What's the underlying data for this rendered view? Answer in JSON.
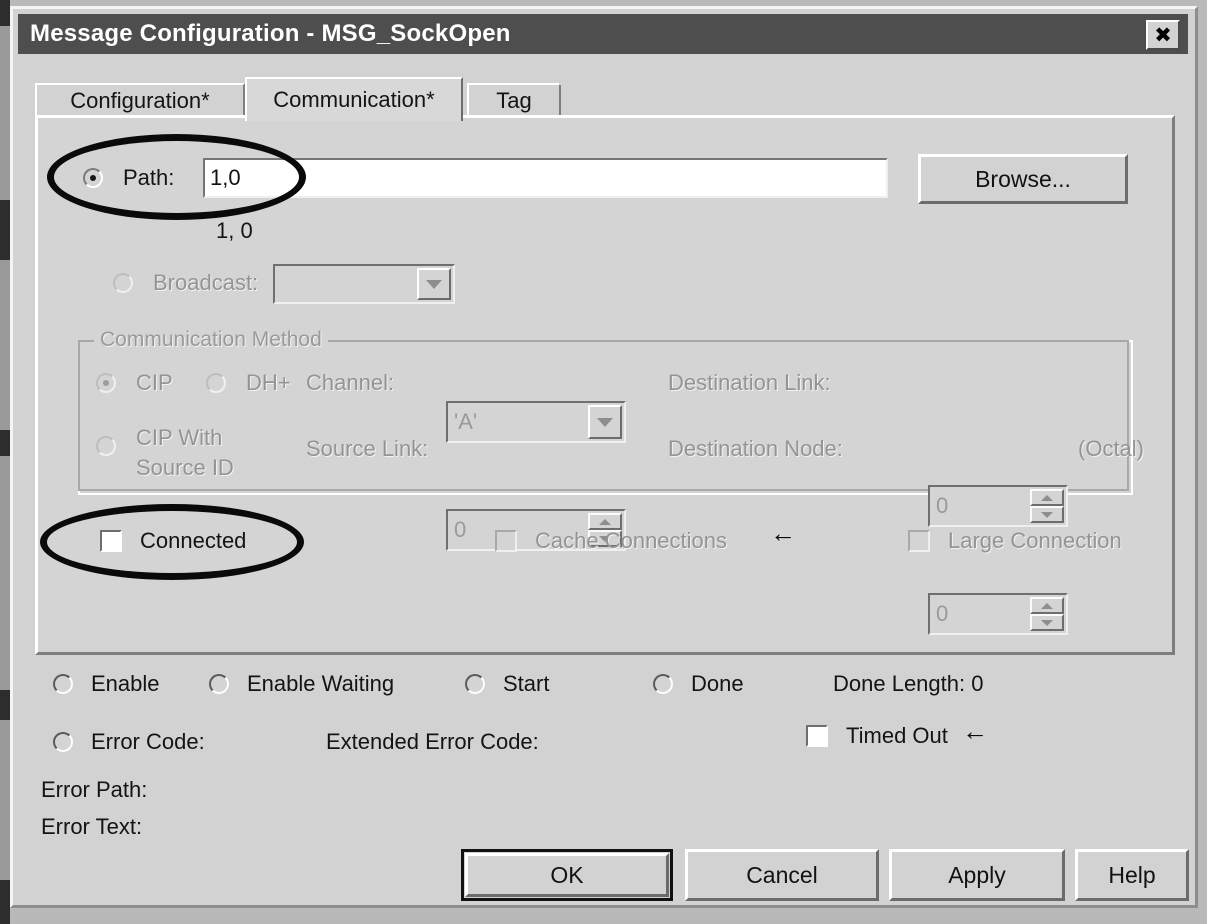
{
  "window": {
    "title": "Message Configuration - MSG_SockOpen",
    "close_label": "✖"
  },
  "tabs": [
    {
      "label": "Configuration*",
      "selected": false
    },
    {
      "label": "Communication*",
      "selected": true
    },
    {
      "label": "Tag",
      "selected": false
    }
  ],
  "communication": {
    "path": {
      "radio_label": "Path:",
      "value": "1,0",
      "resolved_text": "1, 0",
      "browse_label": "Browse..."
    },
    "broadcast": {
      "radio_label": "Broadcast:",
      "value": ""
    },
    "method_group": {
      "title": "Communication Method",
      "cip_label": "CIP",
      "dhplus_label": "DH+",
      "cip_source_id_label_line1": "CIP With",
      "cip_source_id_label_line2": "Source ID",
      "channel_label": "Channel:",
      "channel_value": "'A'",
      "source_link_label": "Source Link:",
      "source_link_value": "0",
      "destination_link_label": "Destination Link:",
      "destination_link_value": "0",
      "destination_node_label": "Destination Node:",
      "destination_node_value": "0",
      "octal_label": "(Octal)"
    },
    "connected_label": "Connected",
    "cache_connections_label": "Cache Connections",
    "large_connection_label": "Large Connection"
  },
  "status": {
    "enable_label": "Enable",
    "enable_waiting_label": "Enable Waiting",
    "start_label": "Start",
    "done_label": "Done",
    "done_length_label": "Done Length:  0",
    "error_code_label": "Error Code:",
    "extended_error_code_label": "Extended Error Code:",
    "timed_out_label": "Timed Out",
    "error_path_label": "Error Path:",
    "error_text_label": "Error Text:"
  },
  "buttons": {
    "ok": "OK",
    "cancel": "Cancel",
    "apply": "Apply",
    "help": "Help"
  },
  "annotations": {
    "arrow_glyph": "←"
  }
}
